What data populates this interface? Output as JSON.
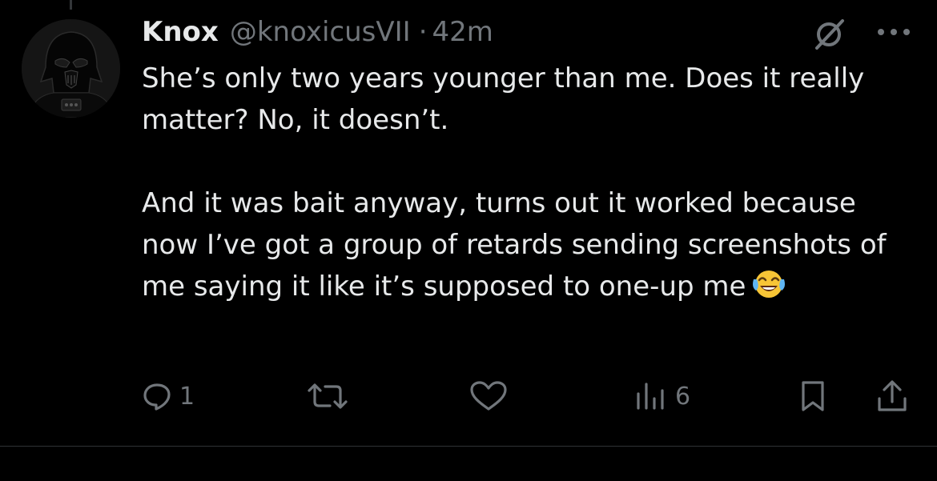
{
  "tweet": {
    "author_name": "Knox",
    "author_handle": "@knoxicusVII",
    "separator": "·",
    "time": "42m",
    "text_lines": {
      "p1": "She’s only two years younger than me. Does it really matter? No, it doesn’t.",
      "p2": "And it was bait anyway, turns out it worked because now I’ve got a group of retards sending screenshots of me saying it like it’s supposed to one-up me"
    },
    "emoji": "face-with-tears-of-joy"
  },
  "actions": {
    "reply_count": "1",
    "views_count": "6"
  },
  "icons": {
    "avatar": "darth-vader-avatar",
    "grok": "grok-icon",
    "more": "more-dots-icon",
    "reply": "reply-icon",
    "retweet": "retweet-icon",
    "like": "heart-icon",
    "views": "views-bar-icon",
    "bookmark": "bookmark-icon",
    "share": "share-icon"
  },
  "colors": {
    "background": "#000000",
    "text": "#e7e9ea",
    "muted": "#71767b",
    "divider": "#2f3336"
  }
}
